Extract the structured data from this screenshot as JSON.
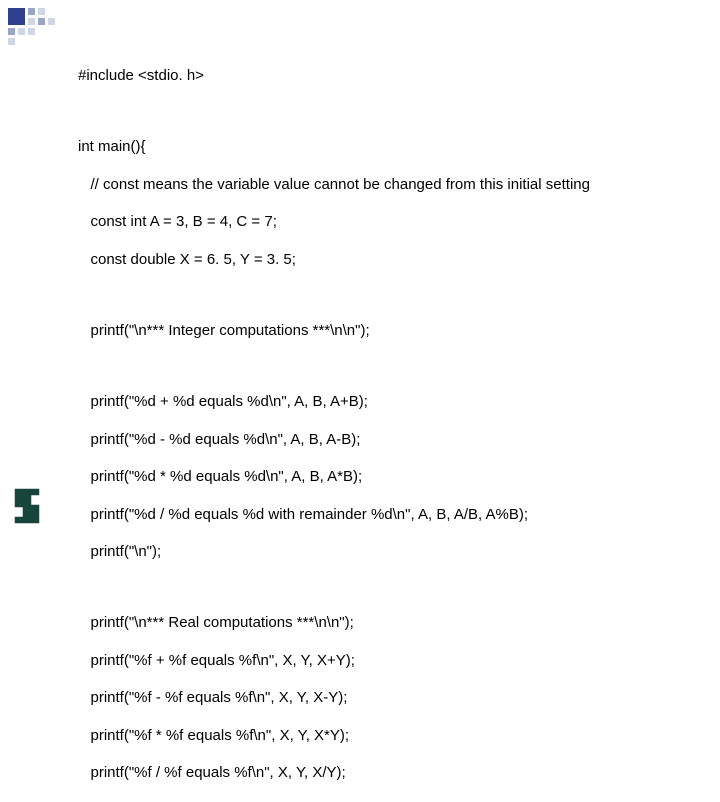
{
  "code": {
    "l01": "#include <stdio. h>",
    "l02": "int main(){",
    "l03": "   // const means the variable value cannot be changed from this initial setting",
    "l04": "   const int A = 3, B = 4, C = 7;",
    "l05": "   const double X = 6. 5, Y = 3. 5;",
    "l06": "   printf(\"\\n*** Integer computations ***\\n\\n\");",
    "l07": "   printf(\"%d + %d equals %d\\n\", A, B, A+B);",
    "l08": "   printf(\"%d - %d equals %d\\n\", A, B, A-B);",
    "l09": "   printf(\"%d * %d equals %d\\n\", A, B, A*B);",
    "l10": "   printf(\"%d / %d equals %d with remainder %d\\n\", A, B, A/B, A%B);",
    "l11": "   printf(\"\\n\");",
    "l12": "   printf(\"\\n*** Real computations ***\\n\\n\");",
    "l13": "   printf(\"%f + %f equals %f\\n\", X, Y, X+Y);",
    "l14": "   printf(\"%f - %f equals %f\\n\", X, Y, X-Y);",
    "l15": "   printf(\"%f * %f equals %f\\n\", X, Y, X*Y);",
    "l16": "   printf(\"%f / %f equals %f\\n\", X, Y, X/Y);"
  }
}
